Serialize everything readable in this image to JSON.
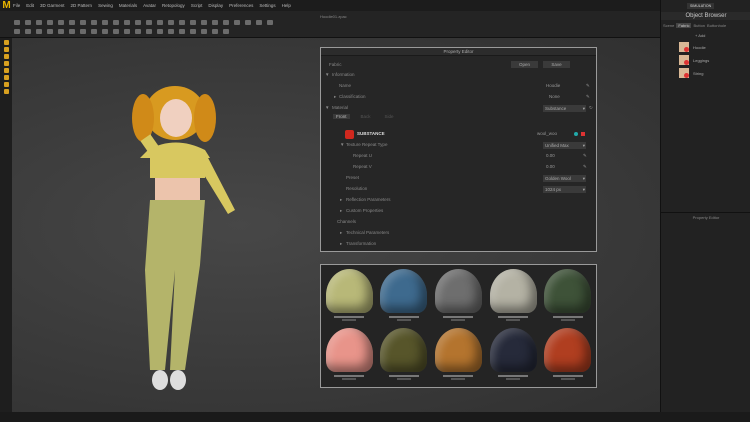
{
  "app": {
    "logo": "M",
    "window_title": "Hoodie01.zpac"
  },
  "menu": [
    "File",
    "Edit",
    "3D Garment",
    "2D Pattern",
    "Sewing",
    "Materials",
    "Avatar",
    "Retopology",
    "Script",
    "Display",
    "Preferences",
    "Settings",
    "Help"
  ],
  "property_editor": {
    "title": "Property Editor",
    "category": "Fabric",
    "open_label": "Open",
    "save_label": "Save",
    "information": {
      "label": "Information",
      "name_label": "Name",
      "name_value": "Hoodie",
      "classification_label": "Classification",
      "classification_value": "None"
    },
    "material": {
      "label": "Material",
      "type_value": "Substance",
      "tabs": [
        "Front",
        "Back",
        "Side"
      ],
      "substance_label": "SUBSTANCE",
      "substance_file": "wool_woo",
      "texture_repeat_label": "Texture Repeat Type",
      "texture_repeat_value": "Unified Max",
      "repeat_u_label": "Repeat U",
      "repeat_u_value": "0.00",
      "repeat_v_label": "Repeat V",
      "repeat_v_value": "0.00",
      "preset_label": "Preset",
      "preset_value": "Golden Wool",
      "resolution_label": "Resolution",
      "resolution_value": "1024 px",
      "reflection_label": "Reflection Parameters",
      "custom_label": "Custom Properties"
    },
    "channels": {
      "label": "Channels",
      "technical_label": "Technical Parameters",
      "transformation_label": "Transformation"
    }
  },
  "materials_grid": {
    "colors": [
      "#b8b878",
      "#3e6a8e",
      "#6e6e6e",
      "#b4b2a4",
      "#3e5238",
      "#e8948a",
      "#57552a",
      "#b4742e",
      "#262a3a",
      "#b03e20"
    ]
  },
  "right_panel": {
    "simulation_label": "SIMULATION",
    "object_browser_label": "Object Browser",
    "tabs": [
      "Scene",
      "Fabric",
      "Button",
      "Buttonhole"
    ],
    "add_label": "Add",
    "objects": [
      "Hoodie",
      "Leggings",
      "String"
    ],
    "property_editor_label": "Property Editor"
  },
  "colors": {
    "accent": "#d4a23a",
    "background": "#3a3a3a"
  }
}
